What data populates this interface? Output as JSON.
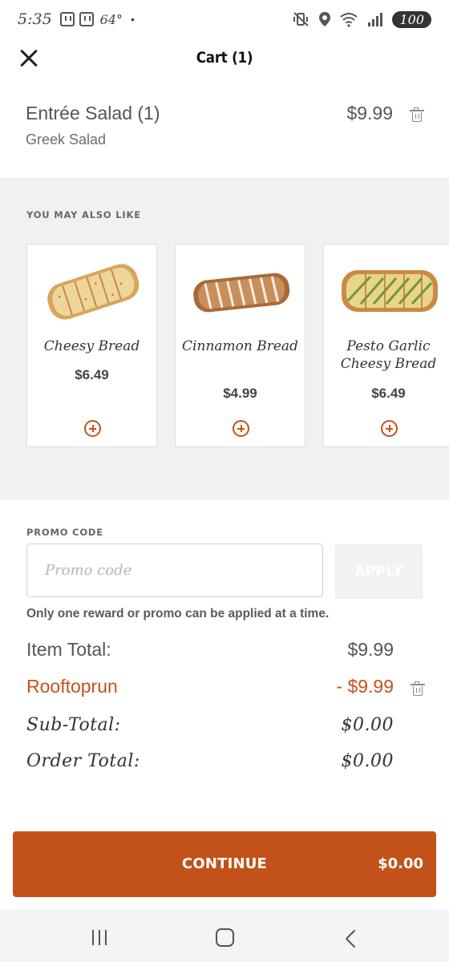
{
  "status_bar": {
    "time": "5:35",
    "temperature": "64°",
    "dot": "•",
    "battery": "100"
  },
  "header": {
    "title": "Cart (1)",
    "close_icon": "close-icon"
  },
  "cart_item": {
    "name": "Entrée Salad (1)",
    "description": "Greek Salad",
    "price": "$9.99"
  },
  "suggestions": {
    "label": "YOU MAY ALSO LIKE",
    "items": [
      {
        "name": "Cheesy Bread",
        "price": "$6.49"
      },
      {
        "name": "Cinnamon Bread",
        "price": "$4.99"
      },
      {
        "name": "Pesto Garlic Cheesy Bread",
        "price": "$6.49"
      }
    ]
  },
  "promo": {
    "label": "PROMO CODE",
    "placeholder": "Promo code",
    "value": "",
    "apply_label": "APPLY",
    "note": "Only one reward or promo can be applied at a time."
  },
  "totals": {
    "item_total_label": "Item Total:",
    "item_total_value": "$9.99",
    "reward_label": "Rooftoprun",
    "reward_value": "- $9.99",
    "subtotal_label": "Sub-Total:",
    "subtotal_value": "$0.00",
    "order_total_label": "Order Total:",
    "order_total_value": "$0.00"
  },
  "continue_button": {
    "label": "CONTINUE",
    "total": "$0.00"
  },
  "colors": {
    "accent": "#c3521a",
    "background_section": "#f1f1f1"
  }
}
